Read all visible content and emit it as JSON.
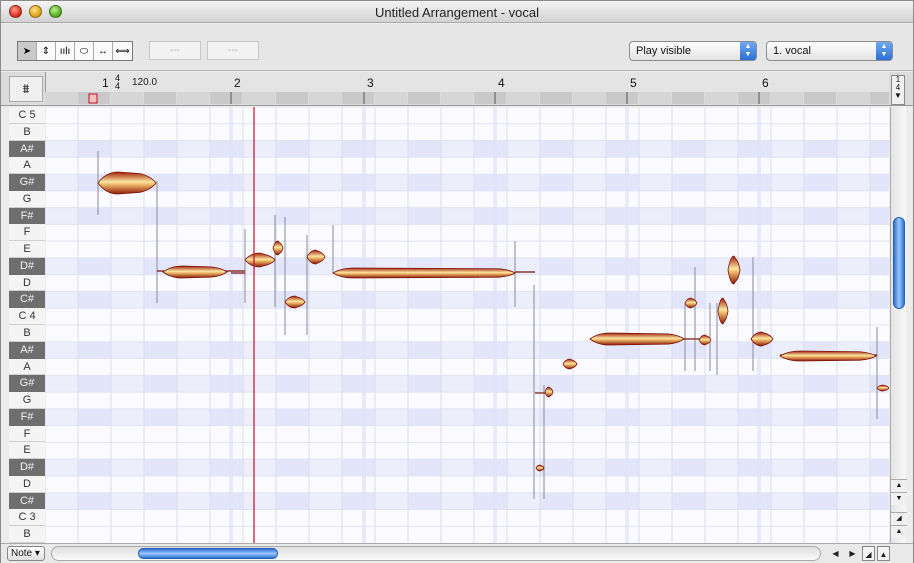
{
  "window": {
    "title": "Untitled Arrangement - vocal"
  },
  "toolbar": {
    "tools": [
      {
        "icon": "arrow-pointer-icon",
        "glyph": "➤"
      },
      {
        "icon": "pitch-tool-icon",
        "glyph": "⇕"
      },
      {
        "icon": "formant-tool-icon",
        "glyph": "ıılı"
      },
      {
        "icon": "amplitude-tool-icon",
        "glyph": "⬭"
      },
      {
        "icon": "time-tool-icon",
        "glyph": "↔"
      },
      {
        "icon": "separation-tool-icon",
        "glyph": "⟺"
      }
    ],
    "field1": "---",
    "field2": "---",
    "play_mode": "Play visible",
    "track": "1. vocal"
  },
  "ruler": {
    "corner_glyph": "⩩",
    "bar1": "1",
    "time_sig_top": "4",
    "time_sig_bottom": "4",
    "tempo": "120.0",
    "bars": [
      "2",
      "3",
      "4",
      "5",
      "6"
    ],
    "right_button_top": "1",
    "right_button_bottom": "4"
  },
  "keys": [
    {
      "label": "C 5",
      "black": false
    },
    {
      "label": "B",
      "black": false
    },
    {
      "label": "A#",
      "black": true
    },
    {
      "label": "A",
      "black": false
    },
    {
      "label": "G#",
      "black": true
    },
    {
      "label": "G",
      "black": false
    },
    {
      "label": "F#",
      "black": true
    },
    {
      "label": "F",
      "black": false
    },
    {
      "label": "E",
      "black": false
    },
    {
      "label": "D#",
      "black": true
    },
    {
      "label": "D",
      "black": false
    },
    {
      "label": "C#",
      "black": true
    },
    {
      "label": "C 4",
      "black": false
    },
    {
      "label": "B",
      "black": false
    },
    {
      "label": "A#",
      "black": true
    },
    {
      "label": "A",
      "black": false
    },
    {
      "label": "G#",
      "black": true
    },
    {
      "label": "G",
      "black": false
    },
    {
      "label": "F#",
      "black": true
    },
    {
      "label": "F",
      "black": false
    },
    {
      "label": "E",
      "black": false
    },
    {
      "label": "D#",
      "black": true
    },
    {
      "label": "D",
      "black": false
    },
    {
      "label": "C#",
      "black": true
    },
    {
      "label": "C 3",
      "black": false
    },
    {
      "label": "B",
      "black": false
    }
  ],
  "blobs": [
    {
      "pitch": "G#",
      "octave": 4
    },
    {
      "pitch": "D#",
      "octave": 4
    },
    {
      "pitch": "D#",
      "octave": 4
    },
    {
      "pitch": "E",
      "octave": 4
    },
    {
      "pitch": "C#",
      "octave": 4
    },
    {
      "pitch": "E",
      "octave": 4
    },
    {
      "pitch": "D#",
      "octave": 4
    },
    {
      "pitch": "D#",
      "octave": 3
    },
    {
      "pitch": "G#",
      "octave": 3
    },
    {
      "pitch": "A",
      "octave": 3
    },
    {
      "pitch": "B",
      "octave": 3
    },
    {
      "pitch": "C#",
      "octave": 4
    },
    {
      "pitch": "B",
      "octave": 3
    },
    {
      "pitch": "C 4",
      "octave": 4
    },
    {
      "pitch": "D#",
      "octave": 4
    },
    {
      "pitch": "B",
      "octave": 3
    },
    {
      "pitch": "A#",
      "octave": 3
    },
    {
      "pitch": "G#",
      "octave": 3
    }
  ],
  "bottom": {
    "note_mode": "Note"
  },
  "colors": {
    "playhead": "#c0102a",
    "blob_edge": "#7a1208",
    "blob_fill": "#f6d27a",
    "grid_tint": "#e3e6fb"
  }
}
